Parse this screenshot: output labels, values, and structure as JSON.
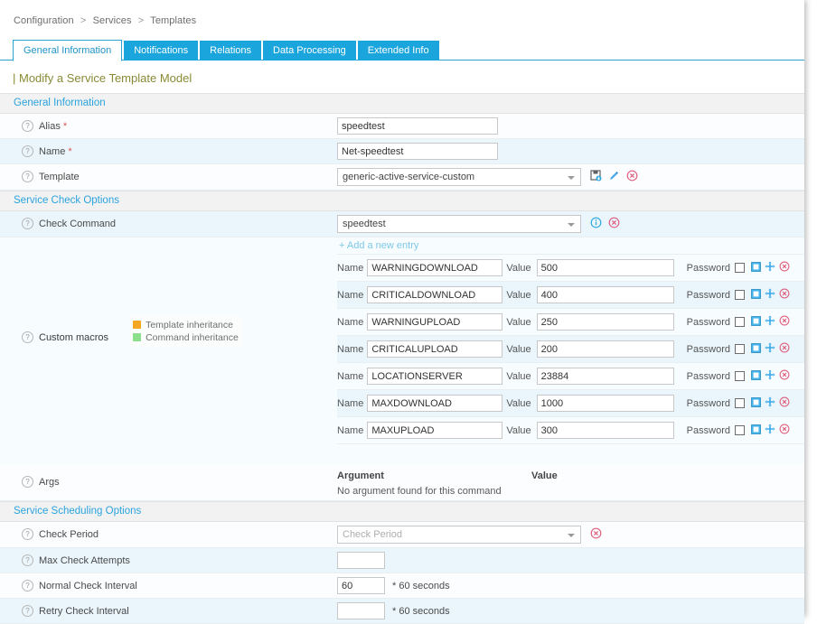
{
  "breadcrumb": {
    "items": [
      "Configuration",
      "Services",
      "Templates"
    ],
    "separator": ">"
  },
  "tabs": [
    {
      "label": "General Information",
      "active": true
    },
    {
      "label": "Notifications",
      "active": false
    },
    {
      "label": "Relations",
      "active": false
    },
    {
      "label": "Data Processing",
      "active": false
    },
    {
      "label": "Extended Info",
      "active": false
    }
  ],
  "page_title": "| Modify a Service Template Model",
  "sections": {
    "general": "General Information",
    "check_options": "Service Check Options",
    "scheduling": "Service Scheduling Options"
  },
  "fields": {
    "alias": {
      "label": "Alias",
      "value": "speedtest",
      "required": "*"
    },
    "name": {
      "label": "Name",
      "value": "Net-speedtest",
      "required": "*"
    },
    "template": {
      "label": "Template",
      "value": "generic-active-service-custom"
    },
    "check_command": {
      "label": "Check Command",
      "value": "speedtest"
    },
    "custom_macros": {
      "label": "Custom macros"
    },
    "args": {
      "label": "Args"
    },
    "check_period": {
      "label": "Check Period",
      "placeholder": "Check Period"
    },
    "max_check_attempts": {
      "label": "Max Check Attempts",
      "value": ""
    },
    "normal_check_interval": {
      "label": "Normal Check Interval",
      "value": "60",
      "suffix": "* 60 seconds"
    },
    "retry_check_interval": {
      "label": "Retry Check Interval",
      "value": "",
      "suffix": "* 60 seconds"
    }
  },
  "add_entry_link": "+ Add a new entry",
  "macro_labels": {
    "name": "Name",
    "value": "Value",
    "password": "Password"
  },
  "macros": [
    {
      "name": "WARNINGDOWNLOAD",
      "value": "500"
    },
    {
      "name": "CRITICALDOWNLOAD",
      "value": "400"
    },
    {
      "name": "WARNINGUPLOAD",
      "value": "250"
    },
    {
      "name": "CRITICALUPLOAD",
      "value": "200"
    },
    {
      "name": "LOCATIONSERVER",
      "value": "23884"
    },
    {
      "name": "MAXDOWNLOAD",
      "value": "1000"
    },
    {
      "name": "MAXUPLOAD",
      "value": "300"
    }
  ],
  "legend": [
    {
      "label": "Template inheritance",
      "color": "#f5a623"
    },
    {
      "label": "Command inheritance",
      "color": "#8ce08c"
    }
  ],
  "args_table": {
    "col_argument": "Argument",
    "col_value": "Value",
    "empty_message": "No argument found for this command"
  },
  "icons": {
    "help": "?",
    "save": "save-icon",
    "edit": "pencil-icon",
    "delete": "delete-circle-icon",
    "info": "info-circle-icon",
    "duplicate": "duplicate-icon",
    "move": "move-arrows-icon",
    "caret": "chevron-down-icon"
  },
  "colors": {
    "tab_active_text": "#2193c9",
    "tab_bg": "#1aa5dd",
    "section_text": "#2ba3dd",
    "title": "#8a8a36",
    "link": "#7ec8ea",
    "required": "#d9534f",
    "delete": "#e0607e",
    "accent_blue": "#2fa8e0"
  }
}
